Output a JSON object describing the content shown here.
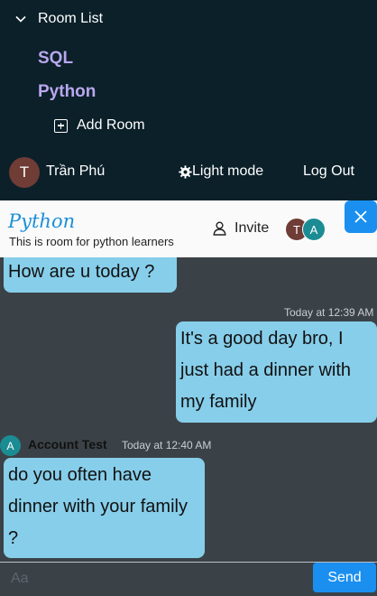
{
  "sidebar": {
    "room_list_label": "Room List",
    "rooms": [
      {
        "label": "SQL"
      },
      {
        "label": "Python"
      }
    ],
    "add_room_label": "Add Room",
    "user": {
      "initial": "T",
      "name": "Trần Phú"
    },
    "light_mode_label": "Light mode",
    "logout_label": "Log Out"
  },
  "room": {
    "title": "Python",
    "description": "This is room for python learners",
    "invite_label": "Invite",
    "members": [
      "T",
      "A"
    ]
  },
  "messages": [
    {
      "text": "How are u today ?",
      "own": false
    },
    {
      "timestamp": "Today at 12:39 AM",
      "text": "It's a good day bro, I just had a dinner with my family",
      "own": true
    },
    {
      "avatar": "A",
      "sender": "Account Test",
      "timestamp": "Today at 12:40 AM",
      "text": "do you often have dinner with your family ?",
      "own": false
    }
  ],
  "composer": {
    "placeholder": "Aa",
    "send_label": "Send"
  },
  "colors": {
    "sidebar_bg": "#0b2029",
    "room_link": "#b9a7ee",
    "chat_bg": "#3b4247",
    "bubble": "#87ceea",
    "accent": "#1a8ff0"
  }
}
